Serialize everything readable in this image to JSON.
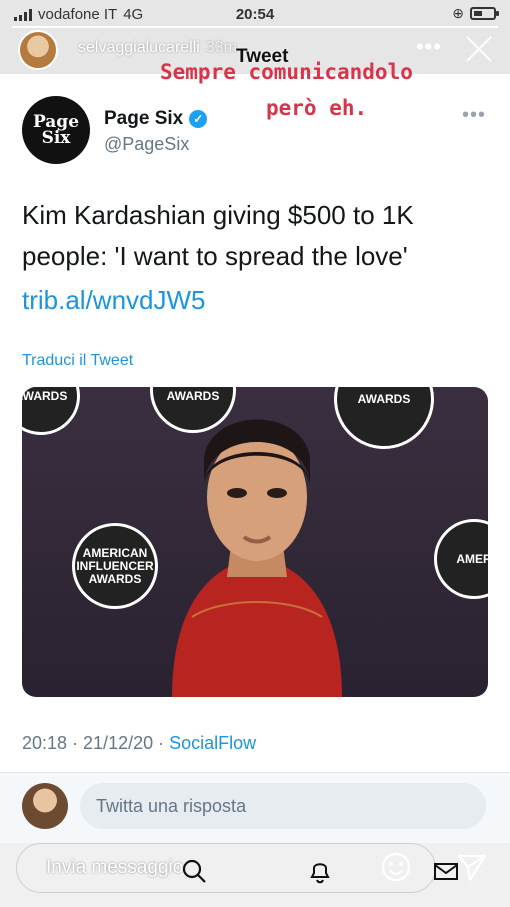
{
  "status_bar": {
    "carrier": "vodafone IT",
    "network": "4G",
    "time": "20:54"
  },
  "story": {
    "username": "selvaggialucarelli",
    "age": "33m",
    "progress": 1.0
  },
  "overlay": {
    "title": "Tweet",
    "caption_line1": "Sempre comunicandolo",
    "caption_line2": "però eh."
  },
  "tweet": {
    "avatar_text": "Page Six",
    "name": "Page Six",
    "handle": "@PageSix",
    "text": "Kim Kardashian giving $500 to 1K people: 'I want to spread the love'",
    "link": "trib.al/wnvdJW5",
    "translate": "Traduci il Tweet",
    "image_logo_text_1": "AMERICAN INFLUENCER AWARDS",
    "image_logo_text_2": "INFLUENCER AWARDS",
    "timestamp": "20:18 · 21/12/20 · ",
    "source": "SocialFlow"
  },
  "reply": {
    "placeholder": "Twitta una risposta"
  },
  "bottom": {
    "message_placeholder": "Invia messaggio"
  },
  "colors": {
    "twitter_blue": "#1b95e0",
    "caption_red": "#d8344a"
  },
  "icons": [
    "signal-icon",
    "battery-icon",
    "close-icon",
    "more-icon",
    "verified-icon",
    "search-icon",
    "bell-icon",
    "emoji-icon",
    "mail-icon",
    "send-icon"
  ]
}
